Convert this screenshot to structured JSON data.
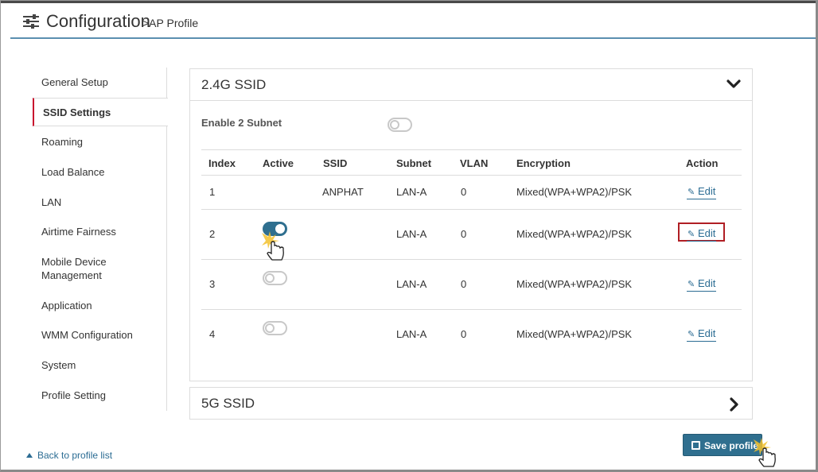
{
  "header": {
    "title": "Configuration",
    "subtitle": ">AP Profile",
    "icon": "sliders-icon"
  },
  "sidebar": {
    "items": [
      {
        "label": "General Setup",
        "active": false
      },
      {
        "label": "SSID Settings",
        "active": true
      },
      {
        "label": "Roaming",
        "active": false
      },
      {
        "label": "Load Balance",
        "active": false
      },
      {
        "label": "LAN",
        "active": false
      },
      {
        "label": "Airtime Fairness",
        "active": false
      },
      {
        "label": "Mobile Device Management",
        "active": false
      },
      {
        "label": "Application",
        "active": false
      },
      {
        "label": "WMM Configuration",
        "active": false
      },
      {
        "label": "System",
        "active": false
      },
      {
        "label": "Profile Setting",
        "active": false
      }
    ],
    "back_link": "Back to profile list"
  },
  "panel_24": {
    "title": "2.4G SSID",
    "expanded": true,
    "enable_subnet_label": "Enable 2 Subnet",
    "enable_subnet_on": false,
    "columns": [
      "Index",
      "Active",
      "SSID",
      "Subnet",
      "VLAN",
      "Encryption",
      "Action"
    ],
    "rows": [
      {
        "index": "1",
        "active_toggle": false,
        "active_on": false,
        "ssid": "ANPHAT",
        "subnet": "LAN-A",
        "vlan": "0",
        "encryption": "Mixed(WPA+WPA2)/PSK",
        "action": "Edit",
        "highlighted": false
      },
      {
        "index": "2",
        "active_toggle": true,
        "active_on": true,
        "ssid": "",
        "subnet": "LAN-A",
        "vlan": "0",
        "encryption": "Mixed(WPA+WPA2)/PSK",
        "action": "Edit",
        "highlighted": true
      },
      {
        "index": "3",
        "active_toggle": true,
        "active_on": false,
        "ssid": "",
        "subnet": "LAN-A",
        "vlan": "0",
        "encryption": "Mixed(WPA+WPA2)/PSK",
        "action": "Edit",
        "highlighted": false
      },
      {
        "index": "4",
        "active_toggle": true,
        "active_on": false,
        "ssid": "",
        "subnet": "LAN-A",
        "vlan": "0",
        "encryption": "Mixed(WPA+WPA2)/PSK",
        "action": "Edit",
        "highlighted": false
      }
    ]
  },
  "panel_5g": {
    "title": "5G SSID",
    "expanded": false
  },
  "save_button": {
    "label": "Save profile"
  },
  "colors": {
    "accent": "#2f6f8f",
    "link": "#2b6c93",
    "active_marker": "#c8102e",
    "highlight_box": "#b01e24"
  }
}
